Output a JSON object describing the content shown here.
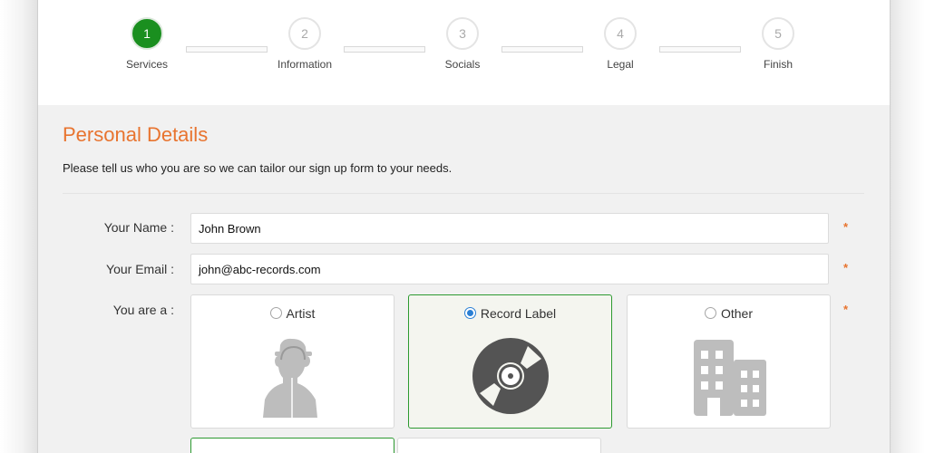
{
  "steps": [
    {
      "num": "1",
      "label": "Services"
    },
    {
      "num": "2",
      "label": "Information"
    },
    {
      "num": "3",
      "label": "Socials"
    },
    {
      "num": "4",
      "label": "Legal"
    },
    {
      "num": "5",
      "label": "Finish"
    }
  ],
  "active_step": 1,
  "section": {
    "title": "Personal Details",
    "subtitle": "Please tell us who you are so we can tailor our sign up form to your needs."
  },
  "form": {
    "name_label": "Your Name :",
    "name_value": "John Brown",
    "email_label": "Your Email :",
    "email_value": "john@abc-records.com",
    "type_label": "You are a :",
    "required_mark": "*",
    "options": [
      {
        "label": "Artist",
        "icon": "artist-silhouette-icon",
        "selected": false
      },
      {
        "label": "Record Label",
        "icon": "vinyl-record-icon",
        "selected": true
      },
      {
        "label": "Other",
        "icon": "building-icon",
        "selected": false
      }
    ]
  },
  "colors": {
    "accent": "#e8742f",
    "step_active": "#1a8f1f",
    "selected_border": "#2d9a31",
    "radio_active": "#2a7fd4"
  }
}
